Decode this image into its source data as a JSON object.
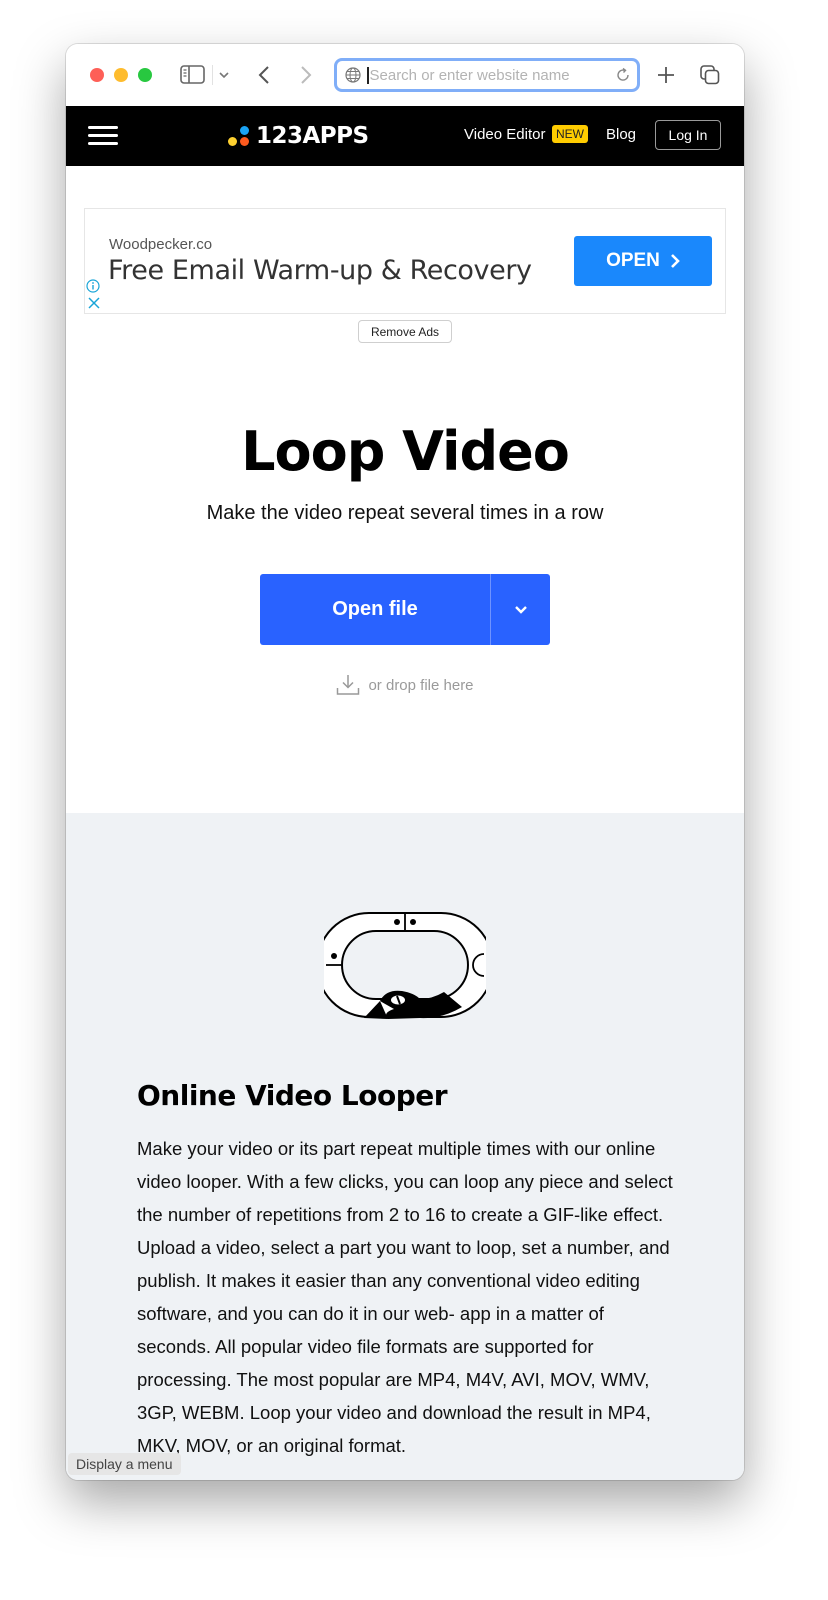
{
  "browser": {
    "url_placeholder": "Search or enter website name",
    "url_value": ""
  },
  "site_header": {
    "logo_text": "123APPS",
    "nav_video_editor": "Video Editor",
    "new_badge": "NEW",
    "nav_blog": "Blog",
    "login_label": "Log In"
  },
  "ad": {
    "domain": "Woodpecker.co",
    "headline": "Free Email Warm-up & Recovery",
    "cta_label": "OPEN",
    "remove_ads_label": "Remove Ads"
  },
  "hero": {
    "title": "Loop Video",
    "subtitle": "Make the video repeat several times in a row",
    "open_file_label": "Open file",
    "drop_hint": "or drop file here"
  },
  "info": {
    "heading": "Online Video Looper",
    "body": "Make your video or its part repeat multiple times with our online video looper. With a few clicks, you can loop any piece and select the number of repetitions from 2 to 16 to create a GIF-like effect. Upload a video, select a part you want to loop, set a number, and publish. It makes it easier than any conventional video editing software, and you can do it in our web- app in a matter of seconds. All popular video file formats are supported for processing. The most popular are MP4, M4V, AVI, MOV, WMV, 3GP, WEBM. Loop your video and download the result in MP4, MKV, MOV, or an original format."
  },
  "status_tooltip": "Display a menu",
  "colors": {
    "primary_button": "#2962ff",
    "ad_button": "#1a88fc",
    "new_badge": "#ffcc00",
    "header_bg": "#000000",
    "info_bg": "#eff2f5"
  }
}
